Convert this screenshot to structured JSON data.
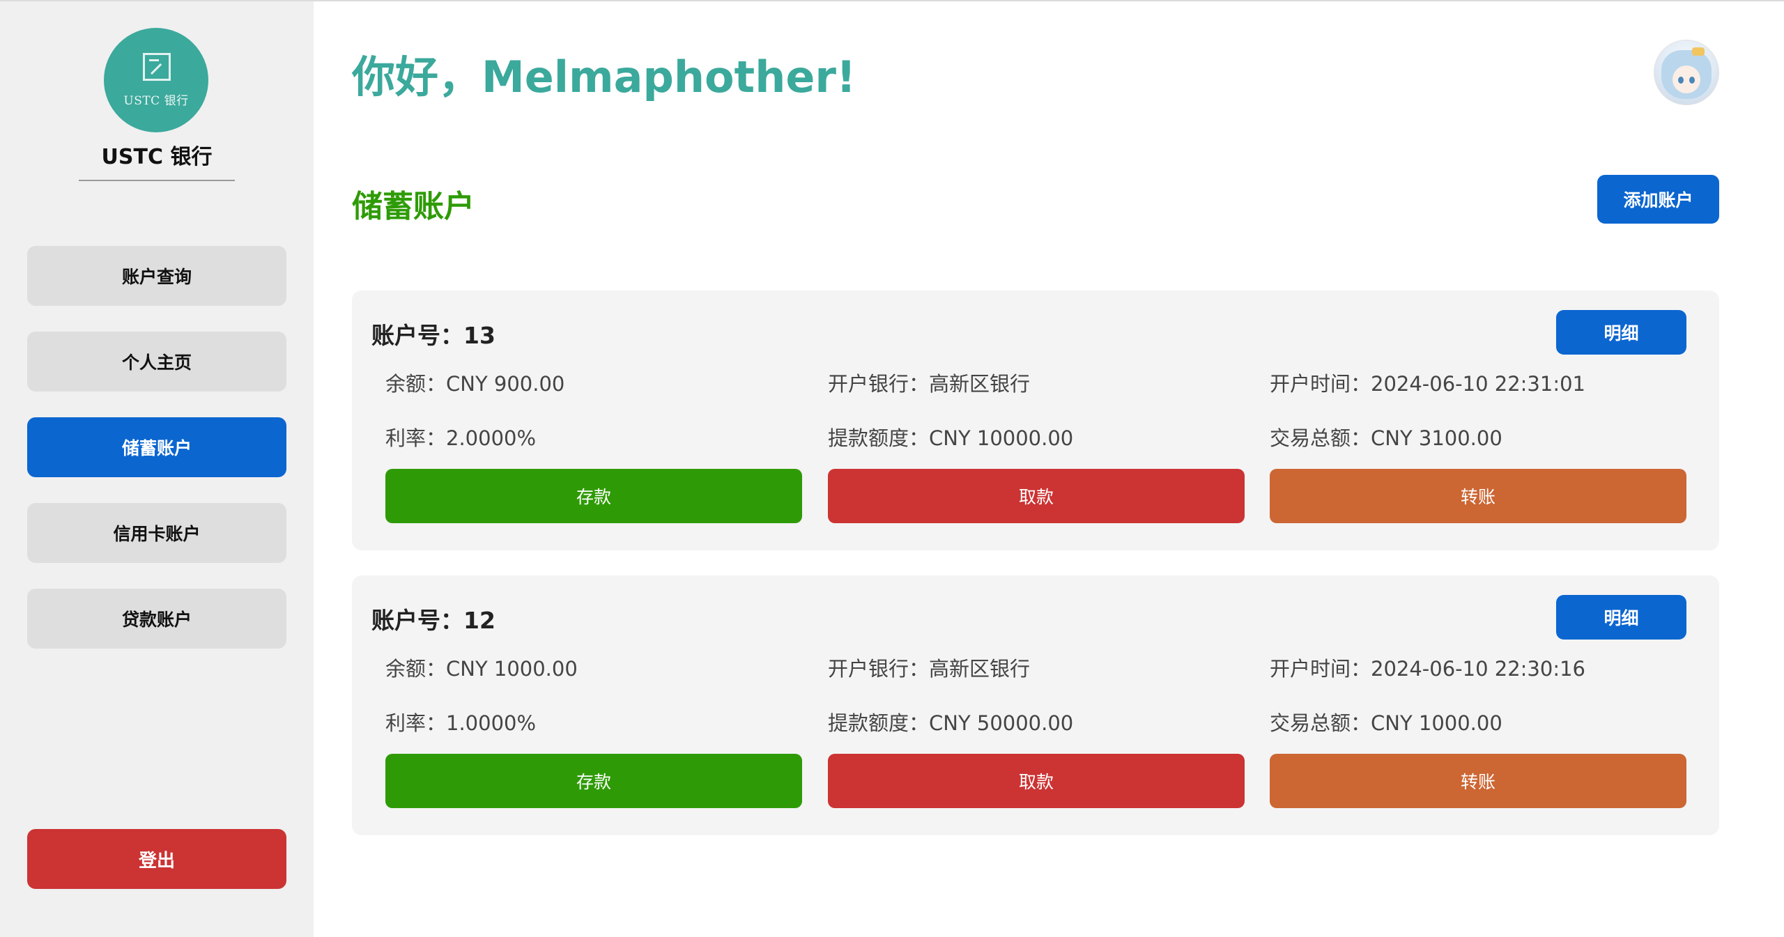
{
  "sidebar": {
    "logo_text": "USTC 银行",
    "brand_name": "USTC 银行",
    "nav": [
      {
        "label": "账户查询",
        "active": false
      },
      {
        "label": "个人主页",
        "active": false
      },
      {
        "label": "储蓄账户",
        "active": true
      },
      {
        "label": "信用卡账户",
        "active": false
      },
      {
        "label": "贷款账户",
        "active": false
      }
    ],
    "logout_label": "登出"
  },
  "header": {
    "greeting": "你好，Melmaphother!"
  },
  "section": {
    "title": "储蓄账户",
    "add_button_label": "添加账户"
  },
  "accounts": [
    {
      "title": "账户号：13",
      "detail_label": "明细",
      "balance": "余额：CNY 900.00",
      "bank": "开户银行：高新区银行",
      "open_time": "开户时间：2024-06-10 22:31:01",
      "rate": "利率：2.0000%",
      "withdraw_limit": "提款额度：CNY 10000.00",
      "total": "交易总额：CNY 3100.00",
      "deposit_label": "存款",
      "withdraw_label": "取款",
      "transfer_label": "转账"
    },
    {
      "title": "账户号：12",
      "detail_label": "明细",
      "balance": "余额：CNY 1000.00",
      "bank": "开户银行：高新区银行",
      "open_time": "开户时间：2024-06-10 22:30:16",
      "rate": "利率：1.0000%",
      "withdraw_limit": "提款额度：CNY 50000.00",
      "total": "交易总额：CNY 1000.00",
      "deposit_label": "存款",
      "withdraw_label": "取款",
      "transfer_label": "转账"
    }
  ],
  "colors": {
    "teal": "#3ba99c",
    "blue": "#0b66d0",
    "green": "#2e9b06",
    "red": "#cc3333",
    "orange": "#cc6633",
    "sidebar_bg": "#f0f0f0",
    "card_bg": "#f4f4f4"
  },
  "icons": {
    "logo": "bank-logo-icon",
    "avatar": "user-avatar"
  }
}
